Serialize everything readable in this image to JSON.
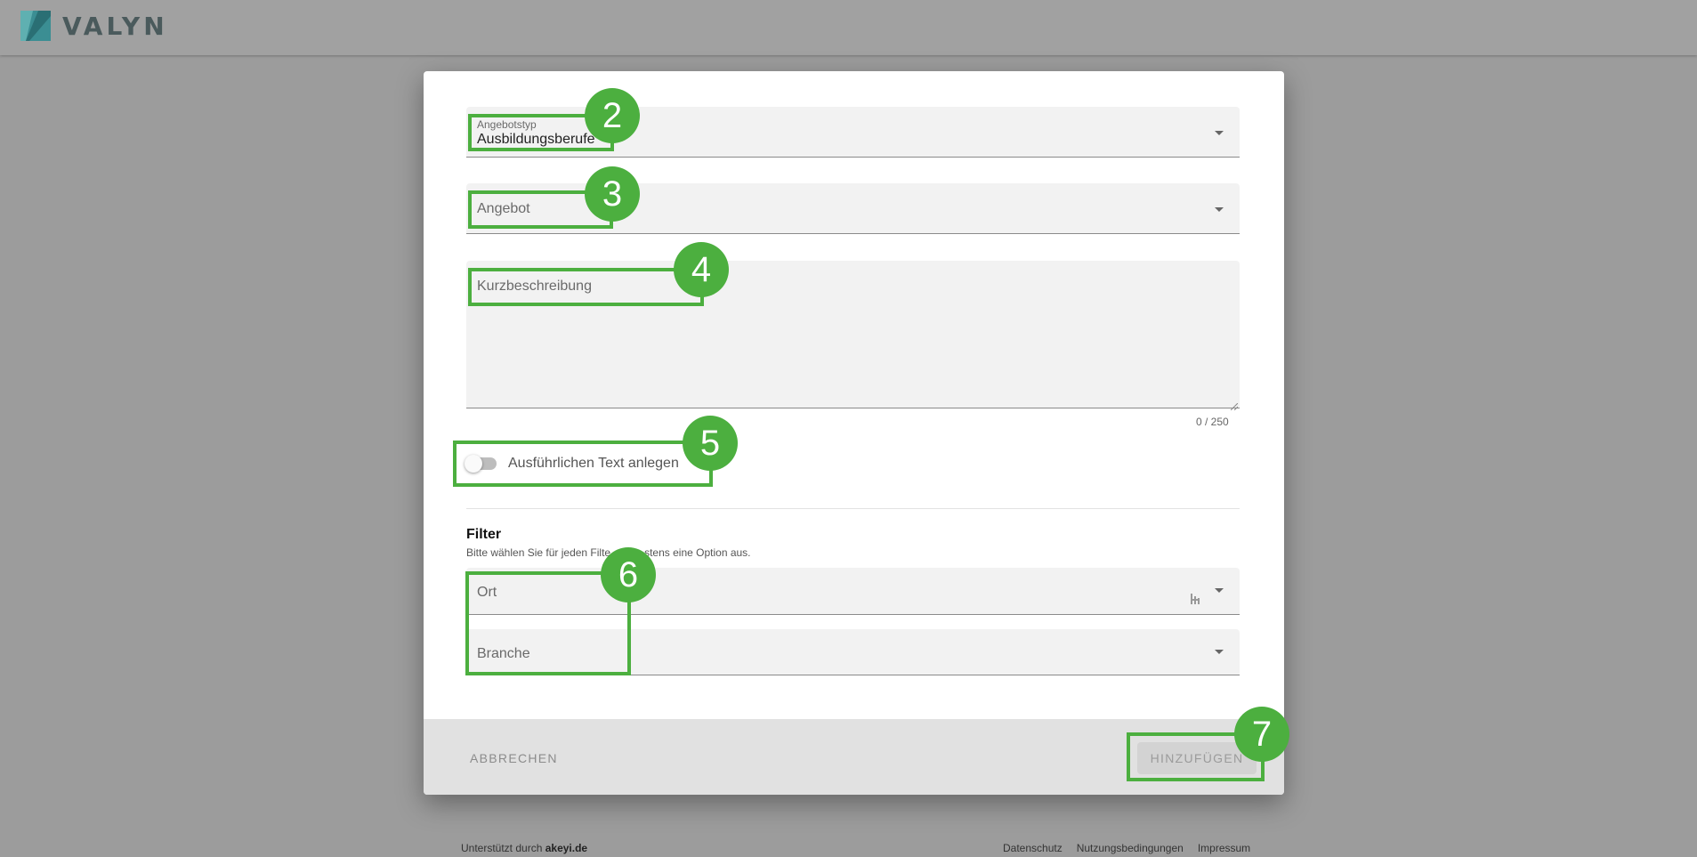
{
  "brand": {
    "name": "VALYN",
    "logo_icon": "valyn-logo-icon"
  },
  "form": {
    "offer_type": {
      "label": "Angebotstyp",
      "value": "Ausbildungsberufe"
    },
    "offer": {
      "placeholder": "Angebot"
    },
    "short_description": {
      "placeholder": "Kurzbeschreibung",
      "counter": "0 / 250"
    },
    "detail_toggle": {
      "label": "Ausführlichen Text anlegen",
      "on": false
    }
  },
  "filter": {
    "title": "Filter",
    "hint": "Bitte wählen Sie für jeden Filter mindestens eine Option aus.",
    "hint_visible_start": "Bitte wählen Sie für jeden Filte",
    "hint_visible_end": "stens eine Option aus.",
    "location": {
      "placeholder": "Ort"
    },
    "industry": {
      "placeholder": "Branche"
    }
  },
  "actions": {
    "cancel_label": "ABBRECHEN",
    "add_label": "HINZUFÜGEN"
  },
  "annotations": [
    "2",
    "3",
    "4",
    "5",
    "6",
    "7"
  ],
  "footer": {
    "powered_prefix": "Unterstützt durch",
    "powered_brand": "akeyi.de",
    "links": [
      "Datenschutz",
      "Nutzungsbedingungen",
      "Impressum"
    ]
  },
  "colors": {
    "highlight": "#4caf3f",
    "overlay": "#9c9c9c",
    "logo_teal": "#2e8b8f"
  }
}
